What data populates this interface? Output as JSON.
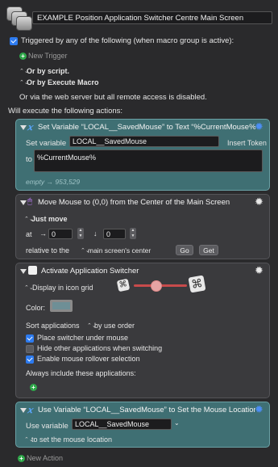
{
  "header": {
    "macro_name": "EXAMPLE Position Application Switcher Centre Main Screen"
  },
  "triggers": {
    "triggered_by_label": "Triggered by any of the following (when macro group is active):",
    "new_trigger_label": "New Trigger",
    "or_by_script": "Or by script.",
    "or_by_execute_macro": "Or by Execute Macro",
    "web_server_note": "Or via the web server but all remote access is disabled.",
    "will_execute_label": "Will execute the following actions:"
  },
  "action1": {
    "title": "Set Variable “LOCAL__SavedMouse” to Text “%CurrentMouse%...",
    "set_variable_label": "Set variable",
    "variable_value": "LOCAL__SavedMouse",
    "insert_token_label": "Insert Token",
    "to_label": "to",
    "text_value": "%CurrentMouse%",
    "result_empty": "empty",
    "result_value": "953,529"
  },
  "action2": {
    "title": "Move Mouse to (0,0) from the Center of the Main Screen",
    "mode_label": "Just move",
    "at_label": "at",
    "x_value": "0",
    "y_value": "0",
    "relative_label": "relative to the",
    "relative_value": "main screen's center",
    "go_label": "Go",
    "get_label": "Get"
  },
  "action3": {
    "title": "Activate Application Switcher",
    "display_label": "Display in icon grid",
    "color_label": "Color:",
    "swatch_color": "#6e8f96",
    "sort_label": "Sort applications",
    "sort_value": "by use order",
    "opt1": "Place switcher under mouse",
    "opt2": "Hide other applications when switching",
    "opt3": "Enable mouse rollover selection",
    "always_include_label": "Always include these applications:"
  },
  "action4": {
    "title": "Use Variable “LOCAL__SavedMouse” to Set the Mouse Location",
    "use_variable_label": "Use variable",
    "variable_value": "LOCAL__SavedMouse",
    "mode_label": "to set the mouse location"
  },
  "footer": {
    "new_action_label": "New Action"
  }
}
